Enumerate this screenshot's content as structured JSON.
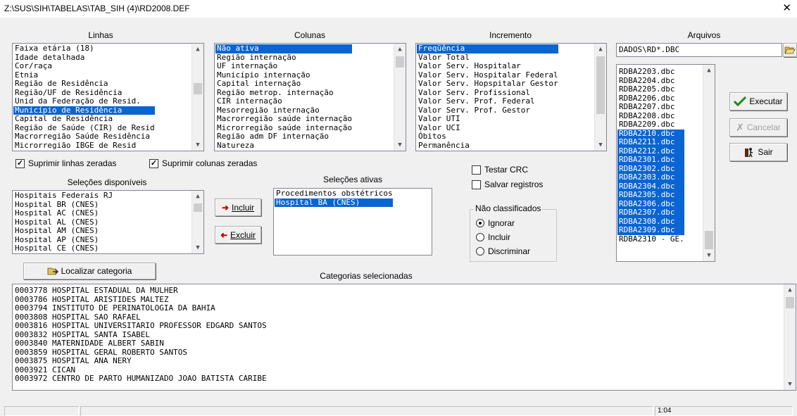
{
  "window": {
    "title": "Z:\\SUS\\SIH\\TABELAS\\TAB_SIH (4)\\RD2008.DEF",
    "close_glyph": "✕"
  },
  "headers": {
    "linhas": "Linhas",
    "colunas": "Colunas",
    "incremento": "Incremento",
    "arquivos": "Arquivos",
    "selecoes_disponiveis": "Seleções disponíveis",
    "selecoes_ativas": "Seleções ativas",
    "categorias_selecionadas": "Categorias selecionadas"
  },
  "linhas": {
    "items": [
      "Faixa etária (18)",
      "Idade detalhada",
      "Cor/raça",
      "Etnia",
      "Região de Residência",
      "Região/UF de Residência",
      "Unid da Federação de Resid.",
      "Município de Residência",
      "Capital de Residência",
      "Região de Saúde (CIR) de Resid",
      "Macrorregião Saúde Residência",
      "Microrregião IBGE de Resid"
    ],
    "selected": 7
  },
  "colunas": {
    "items": [
      "Não ativa",
      "Região internação",
      "UF internação",
      "Município internação",
      "Capital internação",
      "Região metrop. internação",
      "CIR internação",
      "Mesorregião internação",
      "Macrorregião saúde internação",
      "Microrregião saúde internação",
      "Região adm DF internação",
      "Natureza"
    ],
    "selected": 0
  },
  "incremento": {
    "items": [
      "Freqüência",
      "Valor Total",
      "Valor Serv. Hospitalar",
      "Valor Serv. Hospitalar Federal",
      "Valor Serv. Hopspitalar Gestor",
      "Valor Serv. Profissional",
      "Valor Serv. Prof. Federal",
      "Valor Serv. Prof. Gestor",
      "Valor UTI",
      "Valor UCI",
      "Óbitos",
      "Permanência"
    ],
    "selected": 0
  },
  "arquivos": {
    "path": "DADOS\\RD*.DBC",
    "items": [
      "RDBA2203.dbc",
      "RDBA2204.dbc",
      "RDBA2205.dbc",
      "RDBA2206.dbc",
      "RDBA2207.dbc",
      "RDBA2208.dbc",
      "RDBA2209.dbc",
      "RDBA2210.dbc",
      "RDBA2211.dbc",
      "RDBA2212.dbc",
      "RDBA2301.dbc",
      "RDBA2302.dbc",
      "RDBA2303.dbc",
      "RDBA2304.dbc",
      "RDBA2305.dbc",
      "RDBA2306.dbc",
      "RDBA2307.dbc",
      "RDBA2308.dbc",
      "RDBA2309.dbc",
      "RDBA2310 - GE."
    ],
    "selected_from": 7,
    "selected_to": 18
  },
  "buttons": {
    "executar": "Executar",
    "executar_key": "x",
    "cancelar": "Cancelar",
    "sair": "Sair",
    "incluir": "Incluir",
    "excluir": "Excluir",
    "localizar": "Localizar categoria"
  },
  "checkboxes": {
    "suprimir_linhas": "Suprimir linhas zeradas",
    "suprimir_colunas": "Suprimir colunas zeradas",
    "testar_crc": "Testar CRC",
    "salvar_registros": "Salvar registros",
    "suprimir_linhas_checked": true,
    "suprimir_colunas_checked": true,
    "testar_crc_checked": false,
    "salvar_registros_checked": false
  },
  "nao_classificados": {
    "label": "Não classificados",
    "options": [
      "Ignorar",
      "Incluir",
      "Discriminar"
    ],
    "selected": 0
  },
  "selecoes_disponiveis": {
    "items": [
      "Hospitais Federais RJ",
      "Hospital BR (CNES)",
      "Hospital AC (CNES)",
      "Hospital AL (CNES)",
      "Hospital AM (CNES)",
      "Hospital AP (CNES)",
      "Hospital CE (CNES)"
    ]
  },
  "selecoes_ativas": {
    "items": [
      "Procedimentos obstétricos",
      "Hospital BA (CNES)"
    ],
    "selected": 1
  },
  "categorias": {
    "items": [
      "0003778 HOSPITAL ESTADUAL DA MULHER",
      "0003786 HOSPITAL ARISTIDES MALTEZ",
      "0003794 INSTITUTO DE PERINATOLOGIA DA BAHIA",
      "0003808 HOSPITAL SAO RAFAEL",
      "0003816 HOSPITAL UNIVERSITARIO PROFESSOR EDGARD SANTOS",
      "0003832 HOSPITAL SANTA ISABEL",
      "0003840 MATERNIDADE ALBERT SABIN",
      "0003859 HOSPITAL GERAL ROBERTO SANTOS",
      "0003875 HOSPITAL ANA NERY",
      "0003921 CICAN",
      "0003972 CENTRO DE PARTO HUMANIZADO JOAO BATISTA CARIBE"
    ]
  },
  "statusbar": {
    "time": "1:04"
  }
}
